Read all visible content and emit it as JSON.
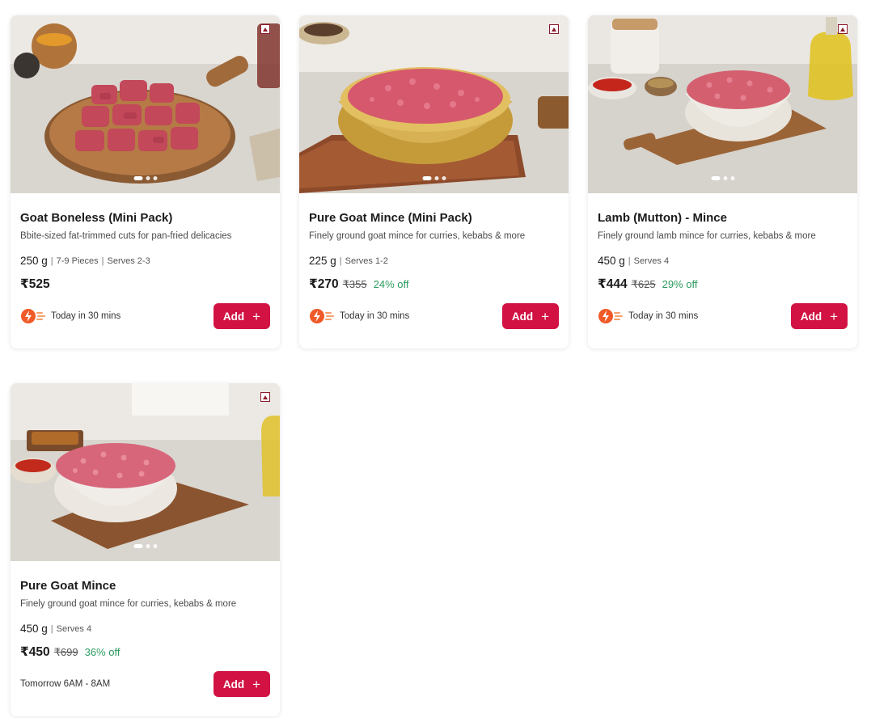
{
  "colors": {
    "accent": "#d11243",
    "discount": "#2c9b5e"
  },
  "products": [
    {
      "title": "Goat Boneless (Mini Pack)",
      "description": "Bbite-sized fat-trimmed cuts for pan-fried delicacies",
      "weight": "250 g",
      "pieces": "7-9 Pieces",
      "serves": "Serves 2-3",
      "price": "₹525",
      "mrp": "",
      "discount": "",
      "delivery": "Today in 30 mins",
      "add_label": "Add",
      "delivery_icon": "express-bolt-icon"
    },
    {
      "title": "Pure Goat Mince (Mini Pack)",
      "description": "Finely ground goat mince for curries, kebabs & more",
      "weight": "225 g",
      "pieces": "",
      "serves": "Serves 1-2",
      "price": "₹270",
      "mrp": "₹355",
      "discount": "24% off",
      "delivery": "Today in 30 mins",
      "add_label": "Add",
      "delivery_icon": "express-bolt-icon"
    },
    {
      "title": "Lamb (Mutton) - Mince",
      "description": "Finely ground lamb mince for curries, kebabs & more",
      "weight": "450 g",
      "pieces": "",
      "serves": "Serves 4",
      "price": "₹444",
      "mrp": "₹625",
      "discount": "29% off",
      "delivery": "Today in 30 mins",
      "add_label": "Add",
      "delivery_icon": "express-bolt-icon"
    },
    {
      "title": "Pure Goat Mince",
      "description": "Finely ground goat mince for curries, kebabs & more",
      "weight": "450 g",
      "pieces": "",
      "serves": "Serves 4",
      "price": "₹450",
      "mrp": "₹699",
      "discount": "36% off",
      "delivery": "Tomorrow 6AM - 8AM",
      "add_label": "Add",
      "delivery_icon": ""
    }
  ]
}
